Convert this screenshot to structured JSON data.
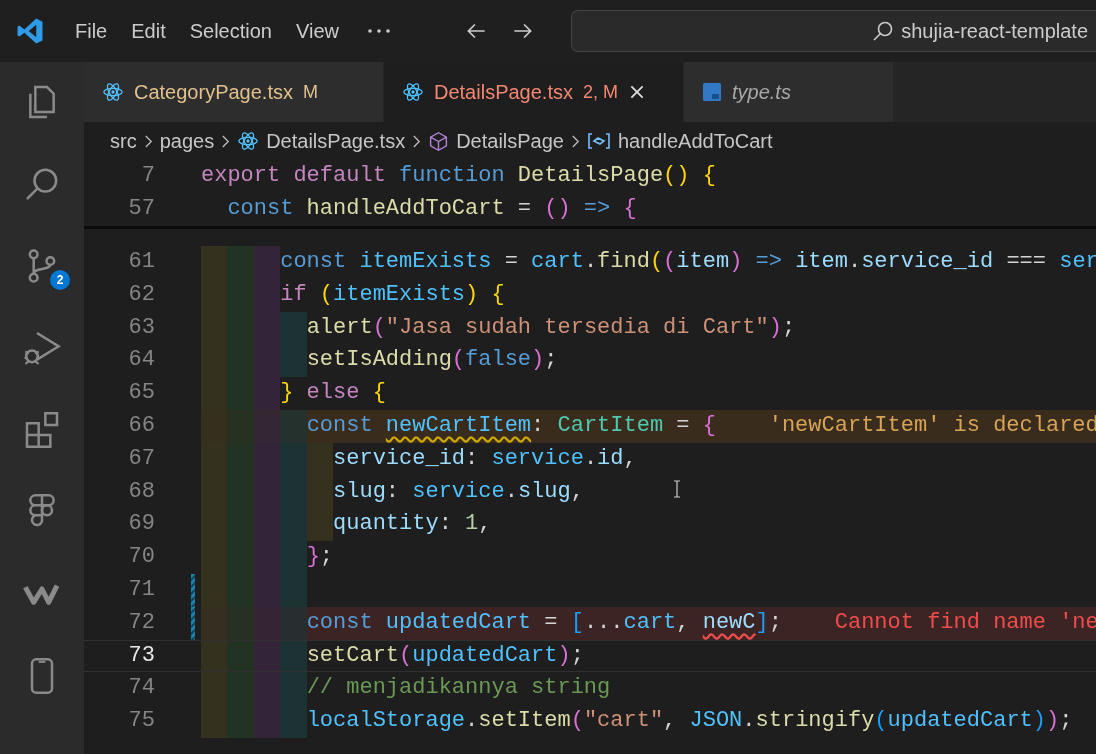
{
  "menu": [
    "File",
    "Edit",
    "Selection",
    "View"
  ],
  "search": {
    "value": "shujia-react-template"
  },
  "activity_bar": {
    "badge": "2"
  },
  "tabs": [
    {
      "label": "CategoryPage.tsx",
      "badge": "M",
      "kind": "react",
      "color": "#e2c08d",
      "preview": false,
      "selected": false
    },
    {
      "label": "DetailsPage.tsx",
      "badge": "2, M",
      "kind": "react",
      "color": "#f48771",
      "preview": false,
      "selected": true
    },
    {
      "label": "type.ts",
      "kind": "typescript",
      "color": "#a8a8a8",
      "preview": true,
      "selected": false
    }
  ],
  "breadcrumb": [
    {
      "label": "src",
      "kind": "folder"
    },
    {
      "label": "pages",
      "kind": "folder"
    },
    {
      "label": "DetailsPage.tsx",
      "kind": "react"
    },
    {
      "label": "DetailsPage",
      "kind": "module"
    },
    {
      "label": "handleAddToCart",
      "kind": "variable"
    }
  ],
  "sticky_lines": [
    {
      "number": "7",
      "tokens": [
        {
          "text": "export",
          "kind": "kw"
        },
        {
          "text": " default",
          "kind": "kw"
        },
        {
          "text": " function",
          "kind": "st"
        },
        {
          "text": " DetailsPage",
          "kind": "fn"
        },
        {
          "text": "()",
          "kind": "b1"
        },
        {
          "text": " {",
          "kind": "b1"
        }
      ]
    },
    {
      "number": "57",
      "tokens": [
        {
          "text": "  const",
          "kind": "st"
        },
        {
          "text": " handleAddToCart",
          "kind": "fn"
        },
        {
          "text": " =",
          "kind": "p"
        },
        {
          "text": " ()",
          "kind": "b2"
        },
        {
          "text": " =>",
          "kind": "st"
        },
        {
          "text": " {",
          "kind": "b2"
        }
      ]
    }
  ],
  "lines": [
    {
      "number": "61",
      "current": false,
      "modified": false,
      "tokens": [
        {
          "text": "      const",
          "kind": "st"
        },
        {
          "text": " itemExists",
          "kind": "cst"
        },
        {
          "text": " =",
          "kind": "p"
        },
        {
          "text": " cart",
          "kind": "cst"
        },
        {
          "text": ".",
          "kind": "p"
        },
        {
          "text": "find",
          "kind": "fn"
        },
        {
          "text": "(",
          "kind": "b1"
        },
        {
          "text": "(",
          "kind": "b2"
        },
        {
          "text": "item",
          "kind": "var"
        },
        {
          "text": ")",
          "kind": "b2"
        },
        {
          "text": " =>",
          "kind": "st"
        },
        {
          "text": " item",
          "kind": "var"
        },
        {
          "text": ".",
          "kind": "p"
        },
        {
          "text": "service_id",
          "kind": "var"
        },
        {
          "text": " ===",
          "kind": "p"
        },
        {
          "text": " ser",
          "kind": "cst"
        }
      ]
    },
    {
      "number": "62",
      "current": false,
      "modified": false,
      "tokens": [
        {
          "text": "      if",
          "kind": "kw"
        },
        {
          "text": " (",
          "kind": "b1"
        },
        {
          "text": "itemExists",
          "kind": "cst"
        },
        {
          "text": ")",
          "kind": "b1"
        },
        {
          "text": " {",
          "kind": "b1"
        }
      ]
    },
    {
      "number": "63",
      "current": false,
      "modified": false,
      "tokens": [
        {
          "text": "        alert",
          "kind": "fn"
        },
        {
          "text": "(",
          "kind": "b2"
        },
        {
          "text": "\"Jasa sudah tersedia di Cart\"",
          "kind": "str"
        },
        {
          "text": ")",
          "kind": "b2"
        },
        {
          "text": ";",
          "kind": "p"
        }
      ]
    },
    {
      "number": "64",
      "current": false,
      "modified": false,
      "tokens": [
        {
          "text": "        setIsAdding",
          "kind": "fn"
        },
        {
          "text": "(",
          "kind": "b2"
        },
        {
          "text": "false",
          "kind": "st"
        },
        {
          "text": ")",
          "kind": "b2"
        },
        {
          "text": ";",
          "kind": "p"
        }
      ]
    },
    {
      "number": "65",
      "current": false,
      "modified": false,
      "tokens": [
        {
          "text": "      }",
          "kind": "b1"
        },
        {
          "text": " else",
          "kind": "kw"
        },
        {
          "text": " {",
          "kind": "b1"
        }
      ]
    },
    {
      "number": "66",
      "current": false,
      "modified": false,
      "diagnostic": {
        "kind": "warning",
        "message": "'newCartItem' is declared"
      },
      "tokens": [
        {
          "text": "        const ",
          "kind": "st"
        },
        {
          "text": "newCartItem",
          "kind": "cst-warn"
        },
        {
          "text": ":",
          "kind": "p"
        },
        {
          "text": " CartItem",
          "kind": "type"
        },
        {
          "text": " =",
          "kind": "p"
        },
        {
          "text": " {",
          "kind": "b2"
        }
      ]
    },
    {
      "number": "67",
      "current": false,
      "modified": false,
      "tokens": [
        {
          "text": "          service_id",
          "kind": "var"
        },
        {
          "text": ":",
          "kind": "p"
        },
        {
          "text": " service",
          "kind": "cst"
        },
        {
          "text": ".",
          "kind": "p"
        },
        {
          "text": "id",
          "kind": "var"
        },
        {
          "text": ",",
          "kind": "p"
        }
      ]
    },
    {
      "number": "68",
      "current": false,
      "modified": false,
      "tokens": [
        {
          "text": "          slug",
          "kind": "var"
        },
        {
          "text": ":",
          "kind": "p"
        },
        {
          "text": " service",
          "kind": "cst"
        },
        {
          "text": ".",
          "kind": "p"
        },
        {
          "text": "slug",
          "kind": "var"
        },
        {
          "text": ",",
          "kind": "p"
        }
      ]
    },
    {
      "number": "69",
      "current": false,
      "modified": false,
      "tokens": [
        {
          "text": "          quantity",
          "kind": "var"
        },
        {
          "text": ":",
          "kind": "p"
        },
        {
          "text": " 1",
          "kind": "num"
        },
        {
          "text": ",",
          "kind": "p"
        }
      ]
    },
    {
      "number": "70",
      "current": false,
      "modified": false,
      "tokens": [
        {
          "text": "        }",
          "kind": "b2"
        },
        {
          "text": ";",
          "kind": "p"
        }
      ]
    },
    {
      "number": "71",
      "current": false,
      "modified": true
    },
    {
      "number": "72",
      "current": false,
      "modified": true,
      "diagnostic": {
        "kind": "error",
        "message": "Cannot find name 'ne"
      },
      "tokens": [
        {
          "text": "        const",
          "kind": "st"
        },
        {
          "text": " updatedCart",
          "kind": "cst"
        },
        {
          "text": " =",
          "kind": "p"
        },
        {
          "text": " [",
          "kind": "b3"
        },
        {
          "text": "...",
          "kind": "p"
        },
        {
          "text": "cart",
          "kind": "cst"
        },
        {
          "text": ", ",
          "kind": "p"
        },
        {
          "text": "newC",
          "kind": "var-err"
        },
        {
          "text": "]",
          "kind": "b3"
        },
        {
          "text": ";",
          "kind": "p"
        }
      ]
    },
    {
      "number": "73",
      "current": true,
      "modified": false,
      "tokens": [
        {
          "text": "        setCart",
          "kind": "fn"
        },
        {
          "text": "(",
          "kind": "b2"
        },
        {
          "text": "updatedCart",
          "kind": "cst"
        },
        {
          "text": ")",
          "kind": "b2"
        },
        {
          "text": ";",
          "kind": "p"
        }
      ]
    },
    {
      "number": "74",
      "current": false,
      "modified": false,
      "tokens": [
        {
          "text": "        // menjadikannya string",
          "kind": "cmt"
        }
      ]
    },
    {
      "number": "75",
      "current": false,
      "modified": false,
      "tokens": [
        {
          "text": "        localStorage",
          "kind": "cst"
        },
        {
          "text": ".",
          "kind": "p"
        },
        {
          "text": "setItem",
          "kind": "fn"
        },
        {
          "text": "(",
          "kind": "b2"
        },
        {
          "text": "\"cart\"",
          "kind": "str"
        },
        {
          "text": ", ",
          "kind": "p"
        },
        {
          "text": "JSON",
          "kind": "cst"
        },
        {
          "text": ".",
          "kind": "p"
        },
        {
          "text": "stringify",
          "kind": "fn"
        },
        {
          "text": "(",
          "kind": "b3"
        },
        {
          "text": "updatedCart",
          "kind": "cst"
        },
        {
          "text": ")",
          "kind": "b3"
        },
        {
          "text": ")",
          "kind": "b2"
        },
        {
          "text": ";",
          "kind": "p"
        }
      ]
    }
  ]
}
